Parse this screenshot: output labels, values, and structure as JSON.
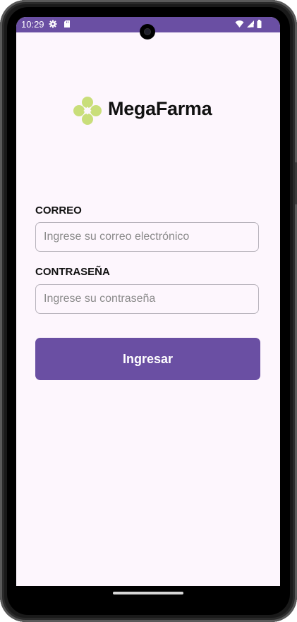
{
  "status_bar": {
    "time": "10:29",
    "icons": [
      "gear-icon",
      "sd-card-icon",
      "wifi-icon",
      "signal-icon",
      "battery-icon"
    ],
    "color": "#6a4fa3"
  },
  "logo": {
    "text": "MegaFarma",
    "mark_color": "#c9de7a"
  },
  "form": {
    "email_label": "CORREO",
    "email_placeholder": "Ingrese su correo electrónico",
    "email_value": "",
    "password_label": "CONTRASEÑA",
    "password_placeholder": "Ingrese su contraseña",
    "password_value": "",
    "submit_label": "Ingresar"
  },
  "colors": {
    "primary": "#6a4fa3",
    "background": "#fdf6fd"
  }
}
